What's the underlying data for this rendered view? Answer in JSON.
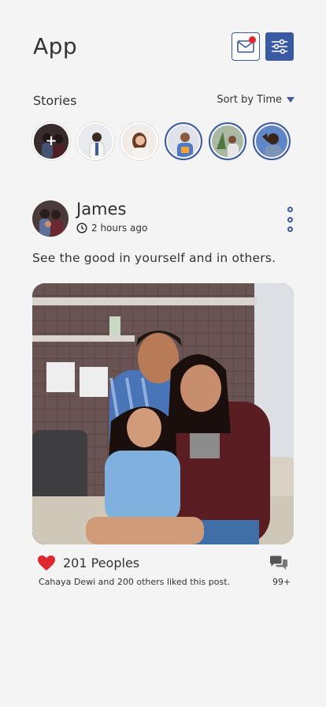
{
  "header": {
    "title": "App",
    "message_icon": "mail-notification-icon",
    "filter_icon": "sliders-icon",
    "accent": "#3b5aa4",
    "notification_color": "#e5242d"
  },
  "stories": {
    "label": "Stories",
    "sort_label": "Sort by Time"
  },
  "post": {
    "author": "James",
    "time": "2 hours ago",
    "text": "See the good in yourself and in others.",
    "likes_count": "201 Peoples",
    "liked_by": "Cahaya Dewi and 200 others liked this post.",
    "comments_count": "99+"
  }
}
